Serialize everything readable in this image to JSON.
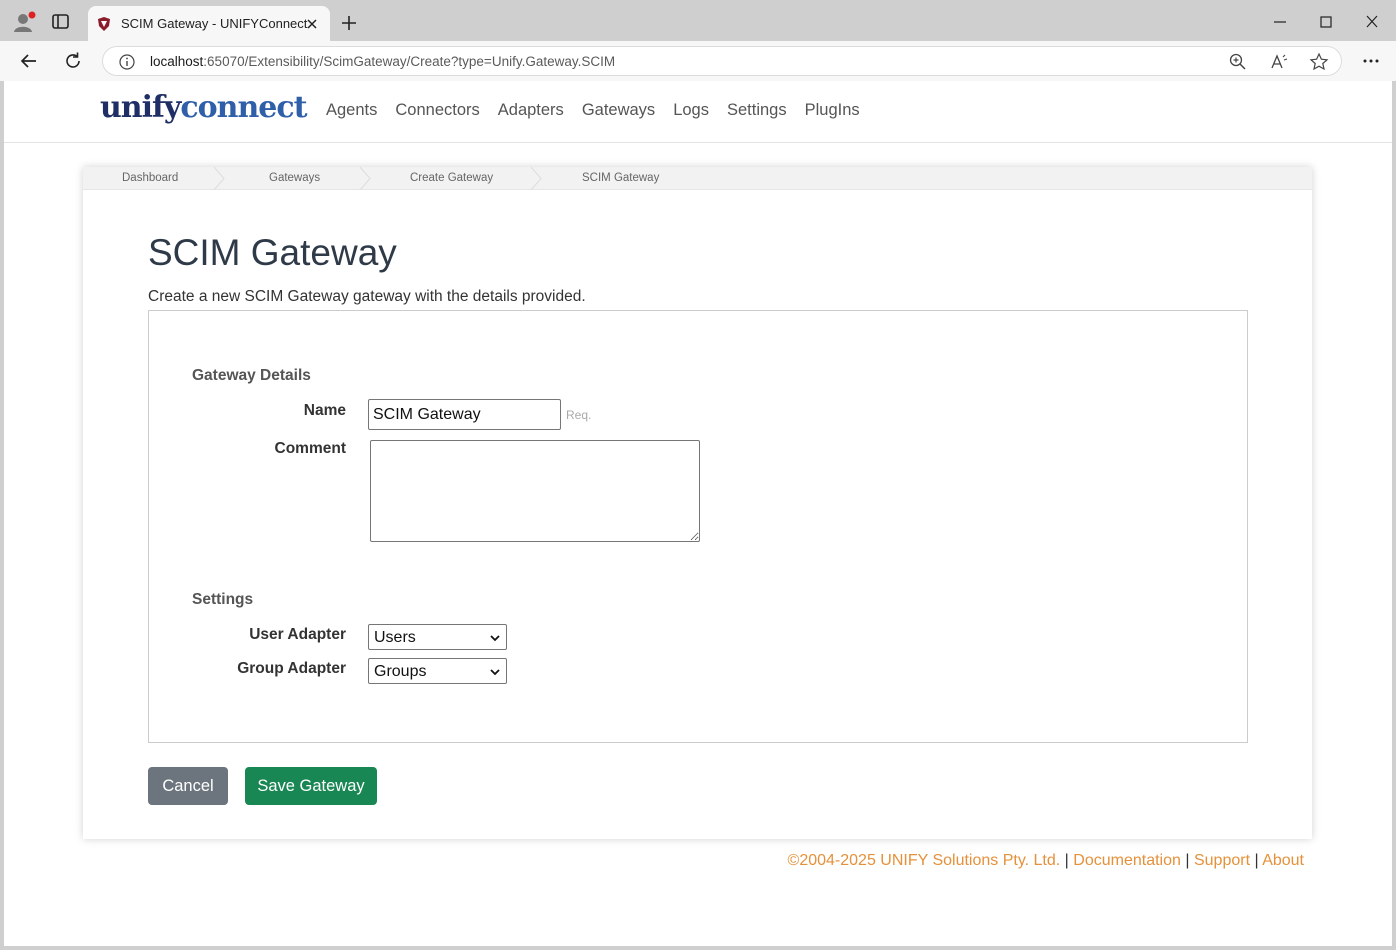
{
  "browser": {
    "tab_title": "SCIM Gateway - UNIFYConnect",
    "url_host": "localhost",
    "url_rest": ":65070/Extensibility/ScimGateway/Create?type=Unify.Gateway.SCIM"
  },
  "brand": {
    "part1": "unify",
    "part2": "connect"
  },
  "nav": {
    "agents": "Agents",
    "connectors": "Connectors",
    "adapters": "Adapters",
    "gateways": "Gateways",
    "logs": "Logs",
    "settings": "Settings",
    "plugins": "PlugIns"
  },
  "breadcrumb": {
    "dashboard": "Dashboard",
    "gateways": "Gateways",
    "create": "Create Gateway",
    "current": "SCIM Gateway"
  },
  "page": {
    "title": "SCIM Gateway",
    "description": "Create a new SCIM Gateway gateway with the details provided."
  },
  "form": {
    "details_heading": "Gateway Details",
    "name_label": "Name",
    "name_value": "SCIM Gateway",
    "required_hint": "Req.",
    "comment_label": "Comment",
    "comment_value": "",
    "settings_heading": "Settings",
    "user_adapter_label": "User Adapter",
    "user_adapter_value": "Users",
    "group_adapter_label": "Group Adapter",
    "group_adapter_value": "Groups"
  },
  "buttons": {
    "cancel": "Cancel",
    "save": "Save Gateway"
  },
  "footer": {
    "copyright": "©2004-2025 UNIFY Solutions Pty. Ltd.",
    "separator": "|",
    "documentation": "Documentation",
    "support": "Support",
    "about": "About"
  },
  "colors": {
    "accent_orange": "#e5913b",
    "save_green": "#198754",
    "cancel_gray": "#6c757d",
    "brand_dark": "#1f2f66",
    "brand_blue": "#2f5fa8"
  },
  "icons": [
    "profile-icon",
    "tabs-icon",
    "favicon",
    "close-icon",
    "new-tab-icon",
    "minimize-icon",
    "maximize-icon",
    "window-close-icon",
    "back-icon",
    "refresh-icon",
    "info-icon",
    "zoom-icon",
    "read-aloud-icon",
    "favorite-icon",
    "more-icon",
    "chevron-down-icon"
  ]
}
